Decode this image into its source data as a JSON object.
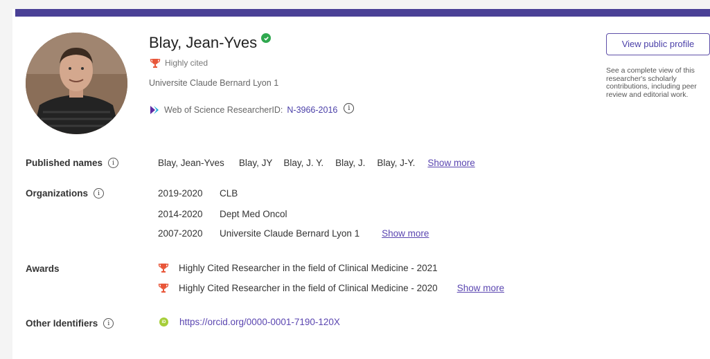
{
  "profile": {
    "name": "Blay, Jean-Yves",
    "badge": "Highly cited",
    "affiliation": "Universite Claude Bernard Lyon 1",
    "rid_label": "Web of Science ResearcherID:",
    "rid_value": "N-3966-2016"
  },
  "public_profile": {
    "button": "View public profile",
    "description": "See a complete view of this researcher's scholarly contributions, including peer review and editorial work."
  },
  "published_names": {
    "label": "Published names",
    "names": [
      "Blay, Jean-Yves",
      "Blay, JY",
      "Blay, J. Y.",
      "Blay, J.",
      "Blay, J-Y."
    ],
    "show_more": "Show more"
  },
  "organizations": {
    "label": "Organizations",
    "items": [
      {
        "years": "2019-2020",
        "name": "CLB"
      },
      {
        "years": "2014-2020",
        "name": "Dept Med Oncol"
      },
      {
        "years": "2007-2020",
        "name": "Universite Claude Bernard Lyon 1"
      }
    ],
    "show_more": "Show more"
  },
  "awards": {
    "label": "Awards",
    "items": [
      "Highly Cited Researcher in the field of Clinical Medicine - 2021",
      "Highly Cited Researcher in the field of Clinical Medicine - 2020"
    ],
    "show_more": "Show more"
  },
  "other_identifiers": {
    "label": "Other Identifiers",
    "orcid": "https://orcid.org/0000-0001-7190-120X"
  },
  "icons": {
    "verified": "check-circle-icon",
    "trophy": "trophy-icon",
    "info": "info-icon",
    "orcid": "orcid-icon",
    "wos": "web-of-science-logo"
  },
  "colors": {
    "top_bar": "#4a4096",
    "link": "#5a45b0",
    "trophy": "#e8573a",
    "verified": "#2fa84f",
    "orcid": "#a6ce39"
  }
}
